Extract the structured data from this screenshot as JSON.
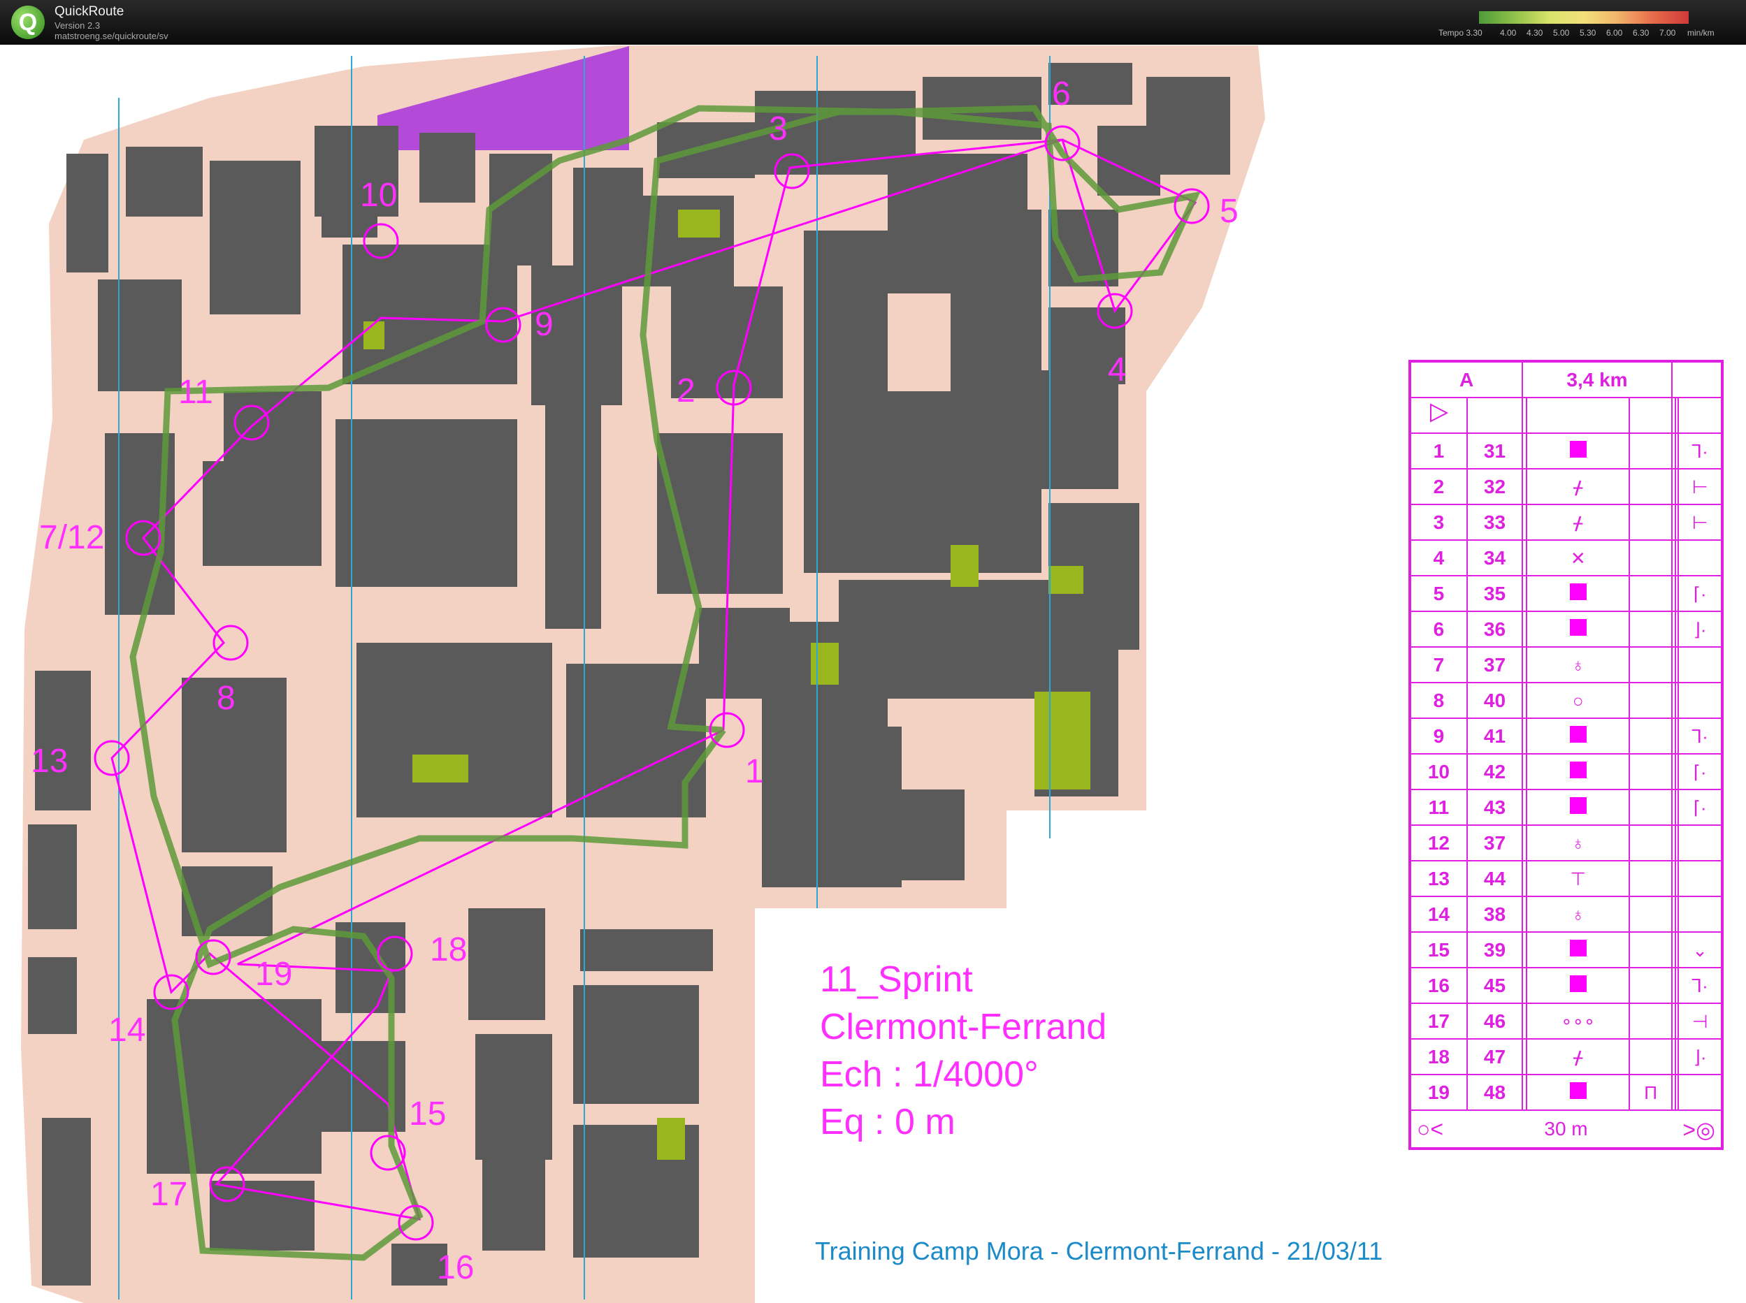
{
  "app": {
    "name": "QuickRoute",
    "version": "Version 2.3",
    "url": "matstroeng.se/quickroute/sv",
    "tempo_labels": [
      "Tempo 3.30",
      "4.00",
      "4.30",
      "5.00",
      "5.30",
      "6.00",
      "6.30",
      "7.00",
      "min/km"
    ]
  },
  "map": {
    "controls": [
      "1",
      "2",
      "3",
      "4",
      "5",
      "6",
      "7/12",
      "8",
      "9",
      "10",
      "11",
      "13",
      "14",
      "15",
      "16",
      "17",
      "18",
      "19"
    ],
    "colors": {
      "building": "#5a5a5a",
      "paved": "#f3d2c4",
      "green": "#9ab61f",
      "course": "#ff00ff",
      "north_lines": "#2aa8d8"
    }
  },
  "legend": {
    "header": {
      "course": "A",
      "length": "3,4 km"
    },
    "rows": [
      {
        "n": "1",
        "code": "31",
        "sym": "box",
        "extra": "",
        "side": "⅂·"
      },
      {
        "n": "2",
        "code": "32",
        "sym": "glyph",
        "glyph": "ᚋ",
        "extra": "",
        "side": "⊢"
      },
      {
        "n": "3",
        "code": "33",
        "sym": "glyph",
        "glyph": "ᚋ",
        "extra": "",
        "side": "⊢"
      },
      {
        "n": "4",
        "code": "34",
        "sym": "glyph",
        "glyph": "✕",
        "extra": "",
        "side": ""
      },
      {
        "n": "5",
        "code": "35",
        "sym": "box",
        "extra": "",
        "side": "⌈·"
      },
      {
        "n": "6",
        "code": "36",
        "sym": "box",
        "extra": "",
        "side": "⌋·"
      },
      {
        "n": "7",
        "code": "37",
        "sym": "glyph",
        "glyph": "♁",
        "extra": "",
        "side": ""
      },
      {
        "n": "8",
        "code": "40",
        "sym": "glyph",
        "glyph": "○",
        "extra": "",
        "side": ""
      },
      {
        "n": "9",
        "code": "41",
        "sym": "box",
        "extra": "",
        "side": "⅂·"
      },
      {
        "n": "10",
        "code": "42",
        "sym": "box",
        "extra": "",
        "side": "⌈·"
      },
      {
        "n": "11",
        "code": "43",
        "sym": "box",
        "extra": "",
        "side": "⌈·"
      },
      {
        "n": "12",
        "code": "37",
        "sym": "glyph",
        "glyph": "♁",
        "extra": "",
        "side": ""
      },
      {
        "n": "13",
        "code": "44",
        "sym": "glyph",
        "glyph": "⊤",
        "extra": "",
        "side": ""
      },
      {
        "n": "14",
        "code": "38",
        "sym": "glyph",
        "glyph": "♁",
        "extra": "",
        "side": ""
      },
      {
        "n": "15",
        "code": "39",
        "sym": "box",
        "extra": "",
        "side": "⌄"
      },
      {
        "n": "16",
        "code": "45",
        "sym": "box",
        "extra": "",
        "side": "⅂·"
      },
      {
        "n": "17",
        "code": "46",
        "sym": "glyph",
        "glyph": "∘∘∘",
        "extra": "",
        "side": "⊣"
      },
      {
        "n": "18",
        "code": "47",
        "sym": "glyph",
        "glyph": "ᚋ",
        "extra": "",
        "side": "⌋·"
      },
      {
        "n": "19",
        "code": "48",
        "sym": "box",
        "extra": "Π",
        "side": ""
      }
    ],
    "finish": {
      "distance": "30 m"
    }
  },
  "event": {
    "line1": "11_Sprint",
    "line2": "Clermont-Ferrand",
    "line3": "Ech : 1/4000°",
    "line4": "Eq : 0 m",
    "footer": "Training Camp Mora - Clermont-Ferrand - 21/03/11"
  }
}
